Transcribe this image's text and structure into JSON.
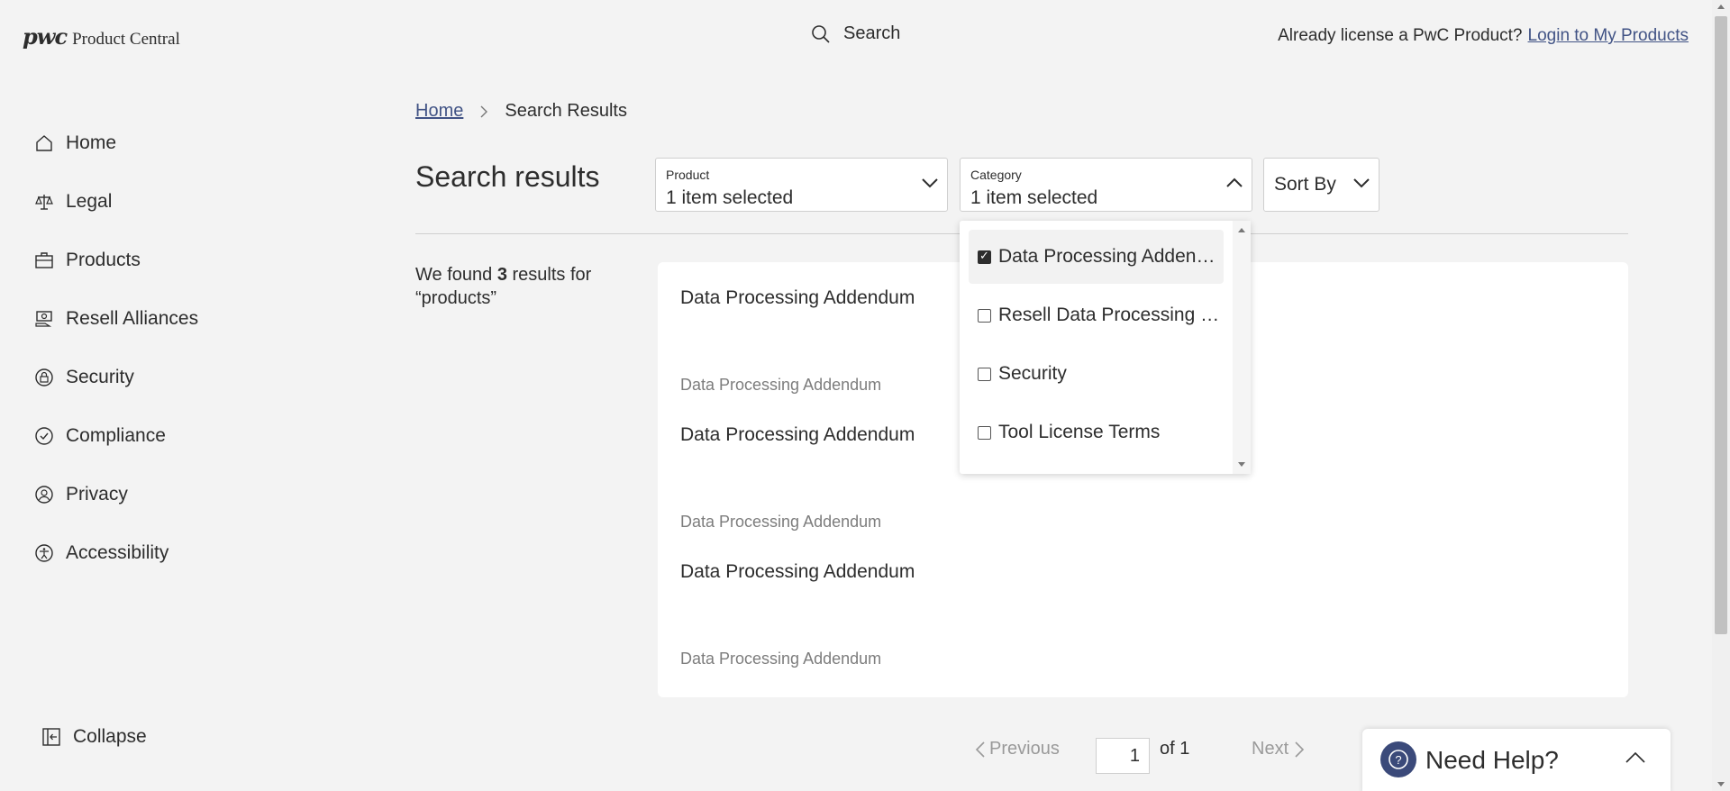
{
  "header": {
    "logo_mark": "pwc",
    "logo_text": "Product Central",
    "search_label": "Search",
    "account_prompt": "Already license a PwC Product?",
    "login_link": "Login to My Products"
  },
  "sidebar": {
    "items": [
      {
        "label": "Home",
        "icon": "home-icon"
      },
      {
        "label": "Legal",
        "icon": "scales-icon"
      },
      {
        "label": "Products",
        "icon": "briefcase-icon"
      },
      {
        "label": "Resell Alliances",
        "icon": "handshake-icon"
      },
      {
        "label": "Security",
        "icon": "lock-icon"
      },
      {
        "label": "Compliance",
        "icon": "check-circle-icon"
      },
      {
        "label": "Privacy",
        "icon": "user-circle-icon"
      },
      {
        "label": "Accessibility",
        "icon": "accessibility-icon"
      }
    ],
    "collapse_label": "Collapse"
  },
  "breadcrumb": {
    "home": "Home",
    "current": "Search Results"
  },
  "page_title": "Search results",
  "filters": {
    "product": {
      "label": "Product",
      "value": "1 item selected"
    },
    "category": {
      "label": "Category",
      "value": "1 item selected"
    },
    "sort": {
      "value": "Sort By"
    }
  },
  "summary": {
    "prefix": "We found",
    "count": "3",
    "middle": "results for",
    "query": "“products”"
  },
  "results": [
    {
      "title": "Data Processing Addendum",
      "subtitle": "Data Processing Addendum"
    },
    {
      "title": "Data Processing Addendum",
      "subtitle": "Data Processing Addendum"
    },
    {
      "title": "Data Processing Addendum",
      "subtitle": "Data Processing Addendum"
    }
  ],
  "category_options": [
    {
      "label": "Data Processing Addendum",
      "checked": true
    },
    {
      "label": "Resell Data Processing addendum",
      "checked": false
    },
    {
      "label": "Security",
      "checked": false
    },
    {
      "label": "Tool License Terms",
      "checked": false
    }
  ],
  "pagination": {
    "previous": "Previous",
    "page": "1",
    "of": "of 1",
    "next": "Next"
  },
  "help": {
    "label": "Need Help?"
  },
  "colors": {
    "background": "#f3f3f3",
    "link": "#415385",
    "help_icon": "#3b4a7a"
  }
}
